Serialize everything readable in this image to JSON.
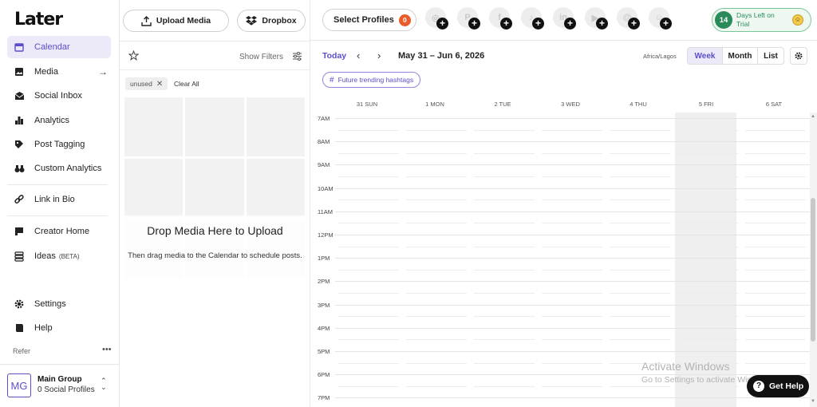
{
  "brand": {
    "logo": "Later",
    "accent": "#5b4fc9"
  },
  "sidebar": {
    "items": [
      {
        "label": "Calendar",
        "icon": "calendar-icon"
      },
      {
        "label": "Media",
        "icon": "image-icon"
      },
      {
        "label": "Social Inbox",
        "icon": "inbox-icon"
      },
      {
        "label": "Analytics",
        "icon": "bar-chart-icon"
      },
      {
        "label": "Post Tagging",
        "icon": "tag-icon"
      },
      {
        "label": "Custom Analytics",
        "icon": "binoculars-icon"
      },
      {
        "label": "Link in Bio",
        "icon": "link-icon"
      },
      {
        "label": "Creator Home",
        "icon": "flag-icon"
      },
      {
        "label": "Ideas",
        "beta": "(BETA)",
        "icon": "ideas-icon"
      },
      {
        "label": "Settings",
        "icon": "gear-icon"
      },
      {
        "label": "Help",
        "icon": "help-book-icon"
      }
    ],
    "refer": "Refer",
    "group": {
      "initials": "MG",
      "name": "Main Group",
      "profiles": "0 Social Profiles"
    }
  },
  "media_panel": {
    "upload_label": "Upload Media",
    "dropbox_label": "Dropbox",
    "show_filters": "Show Filters",
    "chip": "unused",
    "clear_all": "Clear All",
    "drop_title": "Drop Media Here to Upload",
    "drop_sub": "Then drag media to the Calendar to schedule posts."
  },
  "topbar": {
    "select_profiles": "Select Profiles",
    "profiles_count": "0",
    "socials": [
      "instagram-icon",
      "pinterest-icon",
      "facebook-icon",
      "tiktok-icon",
      "linkedin-icon",
      "youtube-icon",
      "threads-icon",
      "snapchat-icon"
    ],
    "trial_days": "14",
    "trial_text": "Days Left on Trial"
  },
  "calendar": {
    "today": "Today",
    "date_range": "May 31 – Jun 6, 2026",
    "timezone": "Africa/Lagos",
    "views": [
      "Week",
      "Month",
      "List"
    ],
    "active_view": "Week",
    "hashtag_button": "Future trending hashtags",
    "days": [
      "31 SUN",
      "1 MON",
      "2 TUE",
      "3 WED",
      "4 THU",
      "5 FRI",
      "6 SAT"
    ],
    "times": [
      "7AM",
      "8AM",
      "9AM",
      "10AM",
      "11AM",
      "12PM",
      "1PM",
      "2PM",
      "3PM",
      "4PM",
      "5PM",
      "6PM",
      "7PM"
    ]
  },
  "overlay": {
    "activate_title": "Activate Windows",
    "activate_sub": "Go to Settings to activate Windows.",
    "get_help": "Get Help"
  }
}
